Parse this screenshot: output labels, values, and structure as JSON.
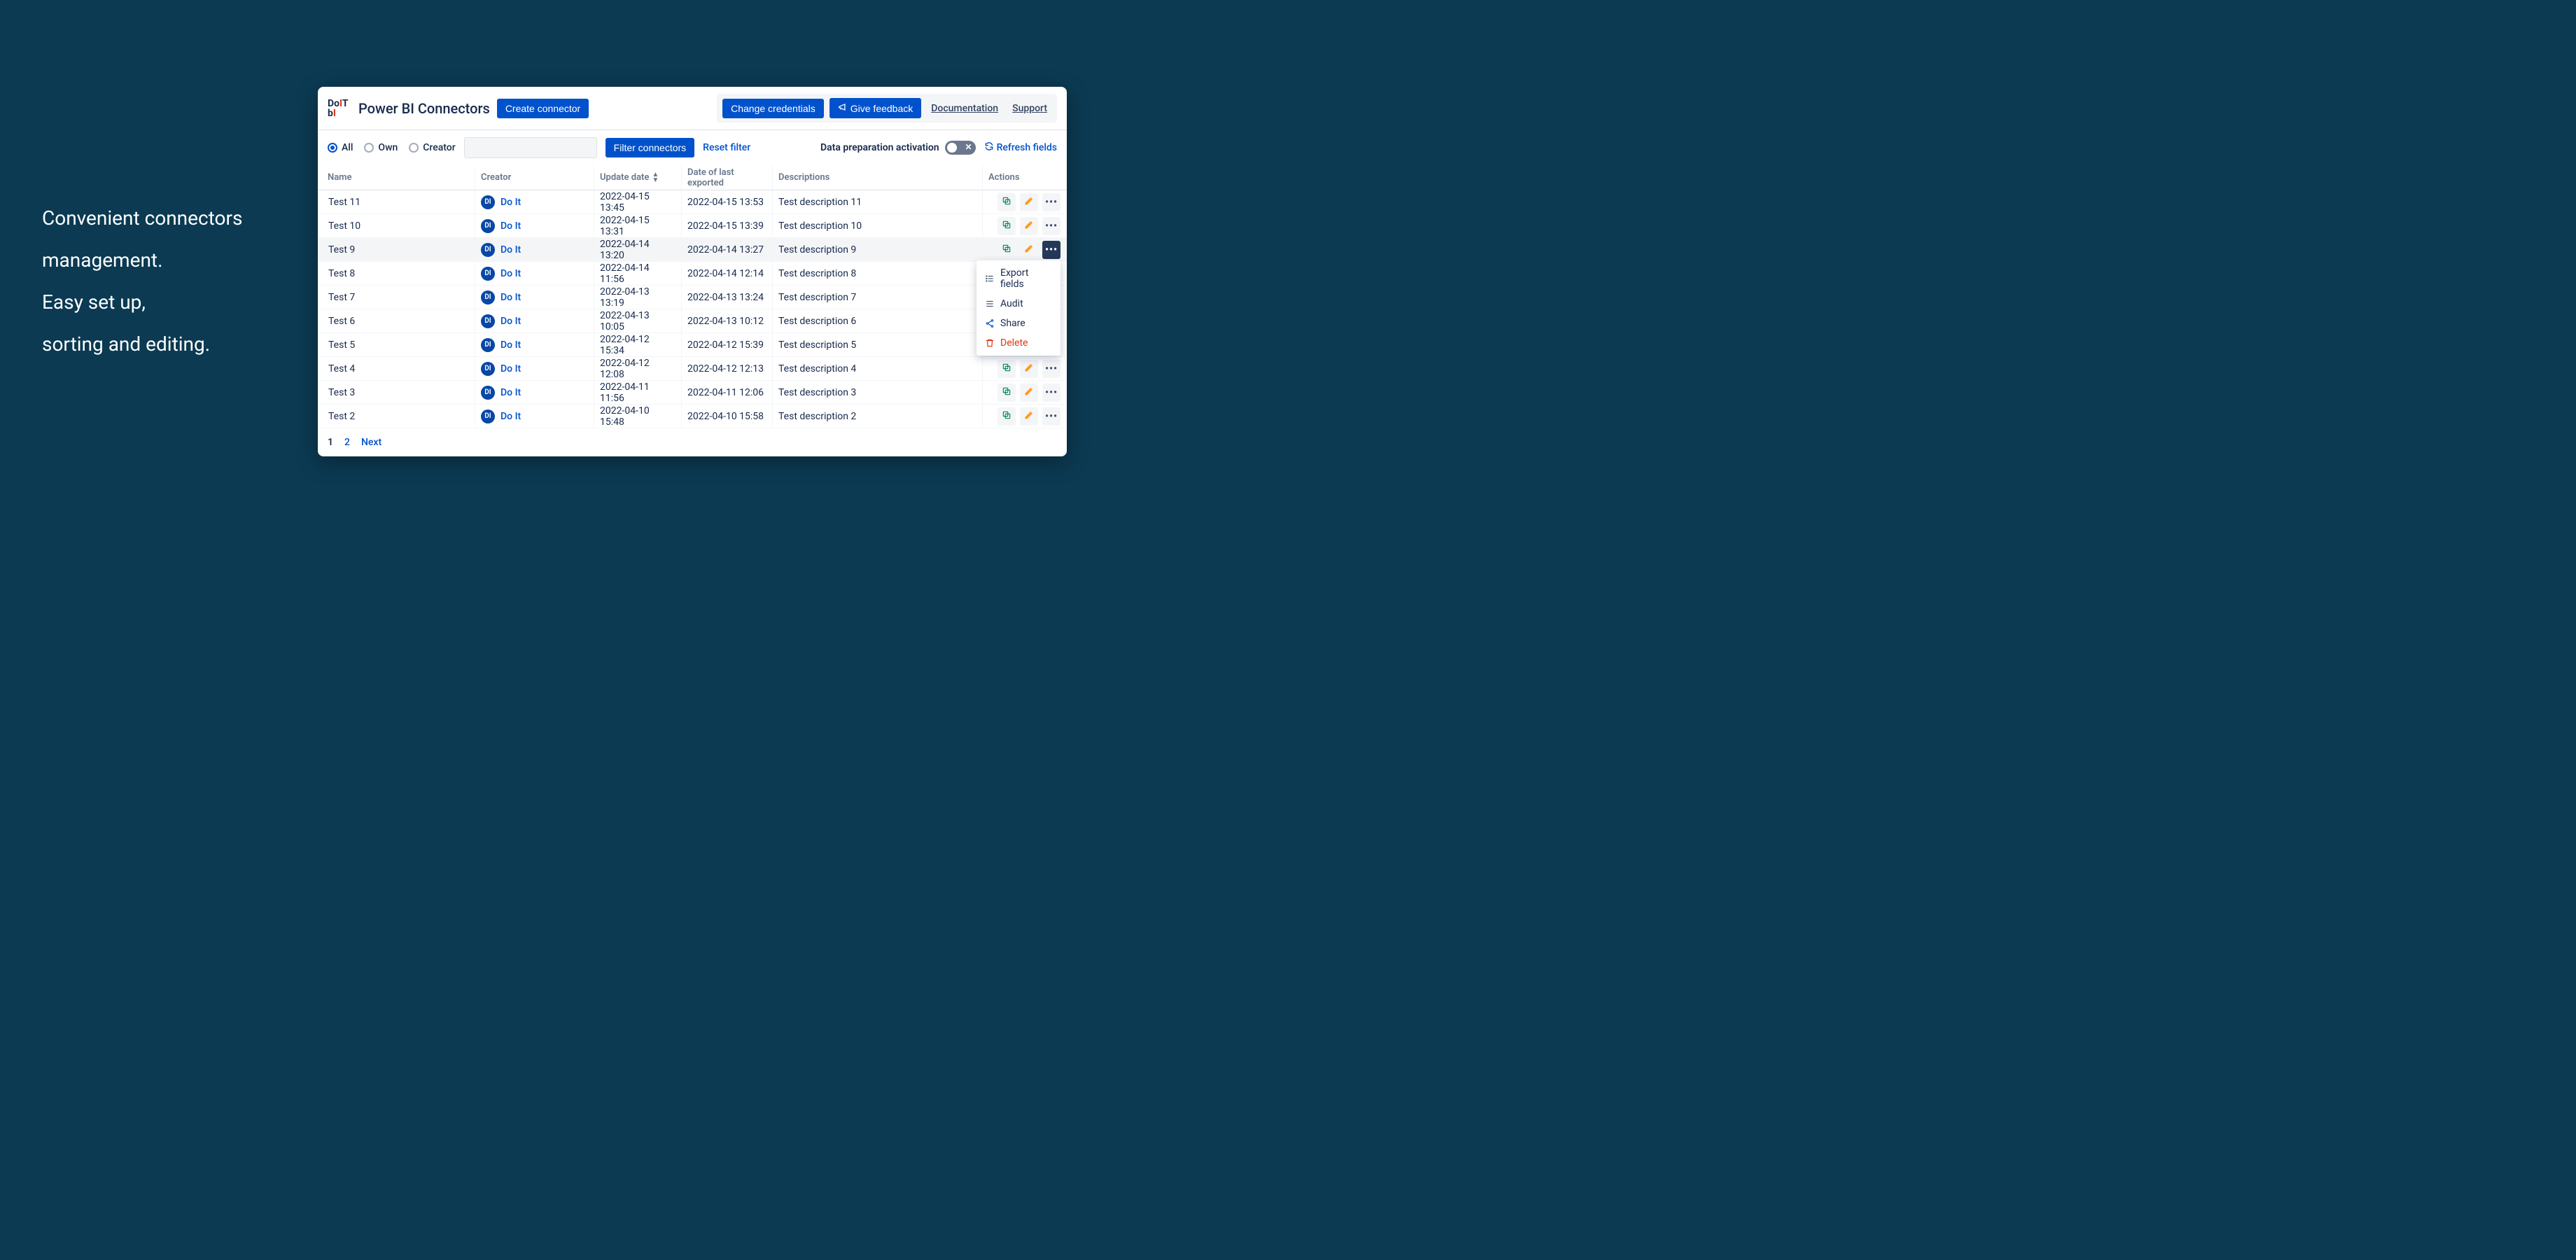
{
  "marketing": {
    "line1": "Convenient connectors",
    "line2": "management.",
    "line3": "Easy set up,",
    "line4": "sorting and editing."
  },
  "header": {
    "logo_top": "Do",
    "logo_top_i": "I",
    "logo_top_t": "T",
    "logo_bot": "b",
    "logo_bot_i": "I",
    "app_title": "Power BI Connectors",
    "create_btn": "Create connector",
    "change_creds": "Change credentials",
    "give_feedback": "Give feedback",
    "documentation": "Documentation",
    "support": "Support"
  },
  "filters": {
    "radio_all": "All",
    "radio_own": "Own",
    "radio_creator": "Creator",
    "selected": "all",
    "filter_btn": "Filter connectors",
    "reset": "Reset filter",
    "data_prep": "Data preparation activation",
    "refresh": "Refresh fields"
  },
  "columns": {
    "name": "Name",
    "creator": "Creator",
    "update_date": "Update date",
    "date_exported": "Date of last exported",
    "descriptions": "Descriptions",
    "actions": "Actions"
  },
  "creator": {
    "initials": "DI",
    "name": "Do It"
  },
  "rows": [
    {
      "name": "Test 11",
      "update": "2022-04-15 13:45",
      "exported": "2022-04-15 13:53",
      "desc": "Test description 11"
    },
    {
      "name": "Test 10",
      "update": "2022-04-15 13:31",
      "exported": "2022-04-15 13:39",
      "desc": "Test description 10"
    },
    {
      "name": "Test 9",
      "update": "2022-04-14 13:20",
      "exported": "2022-04-14 13:27",
      "desc": "Test description 9",
      "menu_open": true
    },
    {
      "name": "Test 8",
      "update": "2022-04-14 11:56",
      "exported": "2022-04-14 12:14",
      "desc": "Test description 8"
    },
    {
      "name": "Test 7",
      "update": "2022-04-13 13:19",
      "exported": "2022-04-13 13:24",
      "desc": "Test description 7"
    },
    {
      "name": "Test 6",
      "update": "2022-04-13 10:05",
      "exported": "2022-04-13 10:12",
      "desc": "Test description 6"
    },
    {
      "name": "Test 5",
      "update": "2022-04-12 15:34",
      "exported": "2022-04-12 15:39",
      "desc": "Test description 5"
    },
    {
      "name": "Test 4",
      "update": "2022-04-12 12:08",
      "exported": "2022-04-12 12:13",
      "desc": "Test description 4"
    },
    {
      "name": "Test 3",
      "update": "2022-04-11 11:56",
      "exported": "2022-04-11 12:06",
      "desc": "Test description 3"
    },
    {
      "name": "Test 2",
      "update": "2022-04-10 15:48",
      "exported": "2022-04-10 15:58",
      "desc": "Test description 2"
    }
  ],
  "menu": {
    "export_fields": "Export fields",
    "audit": "Audit",
    "share": "Share",
    "delete": "Delete"
  },
  "pagination": {
    "p1": "1",
    "p2": "2",
    "next": "Next"
  }
}
